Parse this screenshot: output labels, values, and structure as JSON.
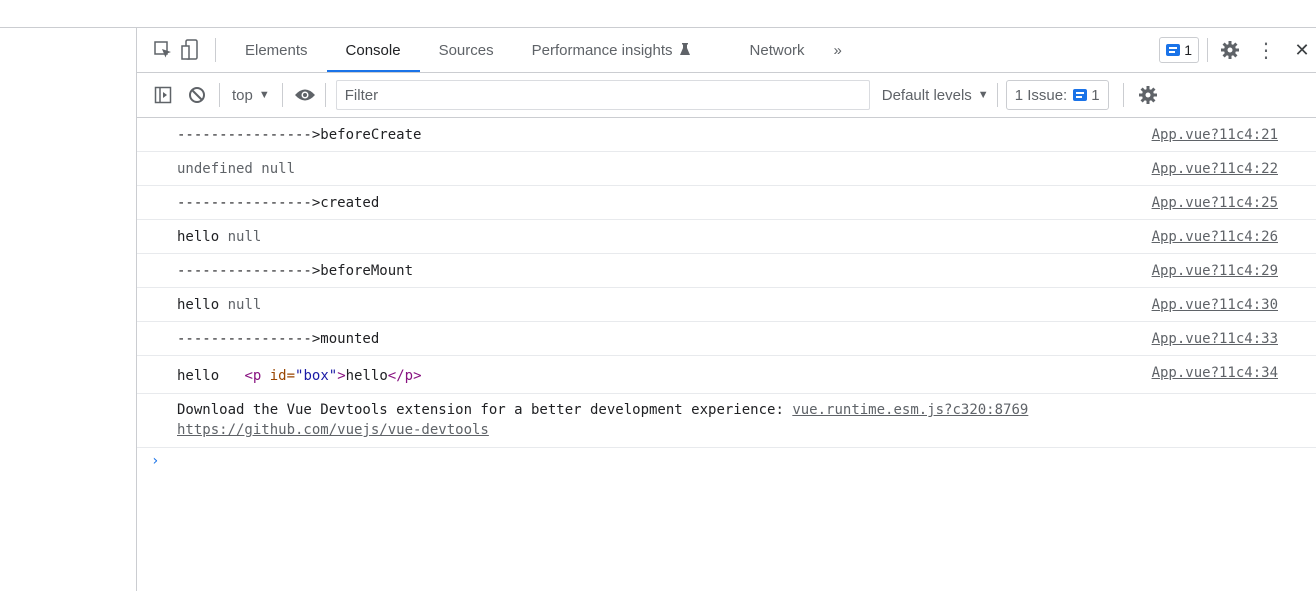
{
  "tabs": [
    {
      "label": "Elements"
    },
    {
      "label": "Console"
    },
    {
      "label": "Sources"
    },
    {
      "label": "Performance insights"
    },
    {
      "label": "Network"
    }
  ],
  "tabbar": {
    "more_tabs": "»",
    "issues_badge_count": "1",
    "more_menu": "⋮",
    "close": "✕"
  },
  "toolbar": {
    "context": "top",
    "filter_placeholder": "Filter",
    "levels": "Default levels",
    "issues_label": "1 Issue:",
    "issues_count": "1"
  },
  "console": {
    "rows": [
      {
        "message": "---------------->beforeCreate",
        "source": "App.vue?11c4:21"
      },
      {
        "message": "undefined null",
        "source": "App.vue?11c4:22"
      },
      {
        "message": "---------------->created",
        "source": "App.vue?11c4:25"
      },
      {
        "message": "hello",
        "extra": "null",
        "source": "App.vue?11c4:26"
      },
      {
        "message": "---------------->beforeMount",
        "source": "App.vue?11c4:29"
      },
      {
        "message": "hello",
        "extra": "null",
        "source": "App.vue?11c4:30"
      },
      {
        "message": "---------------->mounted",
        "source": "App.vue?11c4:33"
      },
      {
        "message": "hello",
        "source": "App.vue?11c4:34",
        "element": {
          "open": "<p",
          "attr": " id=",
          "value": "\"box\"",
          "close": ">",
          "text": "hello",
          "end": "</p>"
        }
      },
      {
        "message": "Download the Vue Devtools extension for a better development experience:",
        "link": "https://github.com/vuejs/vue-devtools",
        "source": "vue.runtime.esm.js?c320:8769"
      }
    ],
    "prompt": "›"
  },
  "colors": {
    "accent": "#1a73e8",
    "border": "#cbcdd1"
  }
}
